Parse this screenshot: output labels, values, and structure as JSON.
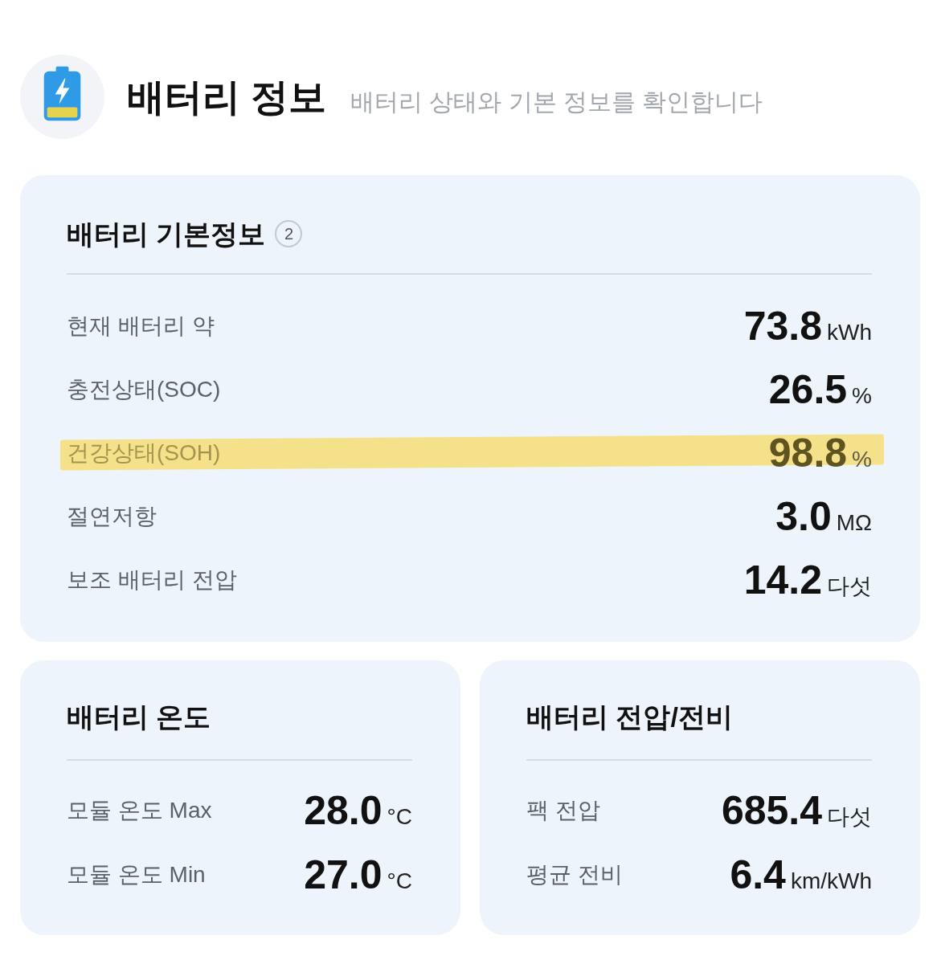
{
  "header": {
    "title": "배터리 정보",
    "subtitle": "배터리 상태와 기본 정보를 확인합니다"
  },
  "basic_info": {
    "title": "배터리 기본정보",
    "badge": "2",
    "rows": [
      {
        "label": "현재 배터리 약",
        "value": "73.8",
        "unit": "kWh",
        "highlighted": false
      },
      {
        "label": "충전상태(SOC)",
        "value": "26.5",
        "unit": "%",
        "highlighted": false
      },
      {
        "label": "건강상태(SOH)",
        "value": "98.8",
        "unit": "%",
        "highlighted": true
      },
      {
        "label": "절연저항",
        "value": "3.0",
        "unit": "MΩ",
        "highlighted": false
      },
      {
        "label": "보조 배터리 전압",
        "value": "14.2",
        "unit": "다섯",
        "highlighted": false
      }
    ]
  },
  "cards": [
    {
      "title": "배터리 온도",
      "rows": [
        {
          "label": "모듈 온도 Max",
          "value": "28.0",
          "unit": "°C"
        },
        {
          "label": "모듈 온도 Min",
          "value": "27.0",
          "unit": "°C"
        }
      ]
    },
    {
      "title": "배터리 전압/전비",
      "rows": [
        {
          "label": "팩 전압",
          "value": "685.4",
          "unit": "다섯"
        },
        {
          "label": "평균 전비",
          "value": "6.4",
          "unit": "km/kWh"
        }
      ]
    }
  ]
}
